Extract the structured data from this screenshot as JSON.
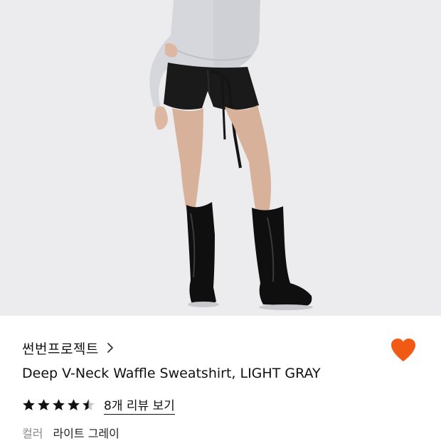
{
  "product": {
    "brand": "썬번프로젝트",
    "title": "Deep V-Neck Waffle Sweatshirt, LIGHT GRAY",
    "rating": 4.5,
    "review_link": "8개 리뷰 보기",
    "color_label": "컬러",
    "color_value": "라이트 그레이",
    "wishlisted": true
  },
  "icons": {
    "brand_chevron": "chevron-right-icon",
    "wishlist": "heart-icon",
    "rating": "star-icon"
  },
  "colors": {
    "accent": "#f15a14",
    "text": "#111111",
    "muted": "#8a8a8a",
    "photo_background": "#ececee"
  }
}
